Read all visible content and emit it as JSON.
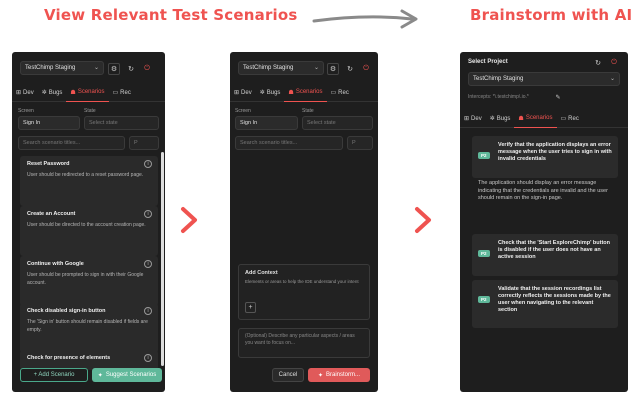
{
  "headings": {
    "left": "View Relevant Test Scenarios",
    "right": "Brainstorm with AI"
  },
  "panel1": {
    "project": "TestChimp Staging",
    "tabs": [
      {
        "icon": "⊞",
        "label": "Dev"
      },
      {
        "icon": "✲",
        "label": "Bugs"
      },
      {
        "icon": "☗",
        "label": "Scenarios"
      },
      {
        "icon": "▭",
        "label": "Rec"
      }
    ],
    "screen_label": "Screen",
    "state_label": "State",
    "screen_value": "Sign In",
    "state_placeholder": "Select state",
    "search_placeholder": "Search scenario titles...",
    "priority_placeholder": "P",
    "scenarios": [
      {
        "title": "Reset Password",
        "desc": "User should be redirected to a reset password page."
      },
      {
        "title": "Create an Account",
        "desc": "User should be directed to the account creation page."
      },
      {
        "title": "Continue with Google",
        "desc": "User should be prompted to sign in with their Google account."
      },
      {
        "title": "Check disabled sign-in button",
        "desc": "The 'Sign in' button should remain disabled if fields are empty."
      },
      {
        "title": "Check for presence of elements",
        "desc": ""
      }
    ],
    "add_button": "+ Add Scenario",
    "suggest_button": "Suggest Scenarios"
  },
  "panel2": {
    "project": "TestChimp Staging",
    "tabs": [
      {
        "icon": "⊞",
        "label": "Dev"
      },
      {
        "icon": "✲",
        "label": "Bugs"
      },
      {
        "icon": "☗",
        "label": "Scenarios"
      },
      {
        "icon": "▭",
        "label": "Rec"
      }
    ],
    "screen_label": "Screen",
    "state_label": "State",
    "screen_value": "Sign In",
    "state_placeholder": "Select state",
    "search_placeholder": "Search scenario titles...",
    "priority_placeholder": "P",
    "context_title": "Add Context",
    "context_desc": "Elements or areas to help the IDE understand your intent",
    "describe_placeholder": "(Optional) Describe any particular aspects / areas you want to focus on...",
    "cancel_button": "Cancel",
    "brainstorm_button": "Brainstorm..."
  },
  "panel3": {
    "select_project_label": "Select Project",
    "project": "TestChimp Staging",
    "intercepts_text": "Intercepts: *\\.testchimp\\.io.*",
    "tabs": [
      {
        "icon": "⊞",
        "label": "Dev"
      },
      {
        "icon": "✲",
        "label": "Bugs"
      },
      {
        "icon": "☗",
        "label": "Scenarios"
      },
      {
        "icon": "▭",
        "label": "Rec"
      }
    ],
    "suggestions": [
      {
        "badge": "P2",
        "title": "Verify that the application displays an error message when the user tries to sign in with invalid credentials"
      },
      {
        "badge": "P2",
        "title": "Check that the 'Start ExploreChimp' button is disabled if the user does not have an active session"
      },
      {
        "badge": "P2",
        "title": "Validate that the session recordings list correctly reflects the sessions made by the user when navigating to the relevant section"
      }
    ],
    "explanation": "The application should display an error message indicating that the credentials are invalid and the user should remain on the sign-in page."
  },
  "colors": {
    "accent": "#ef5350",
    "panel_bg": "#1e1e1e",
    "green": "#5fb89a"
  }
}
